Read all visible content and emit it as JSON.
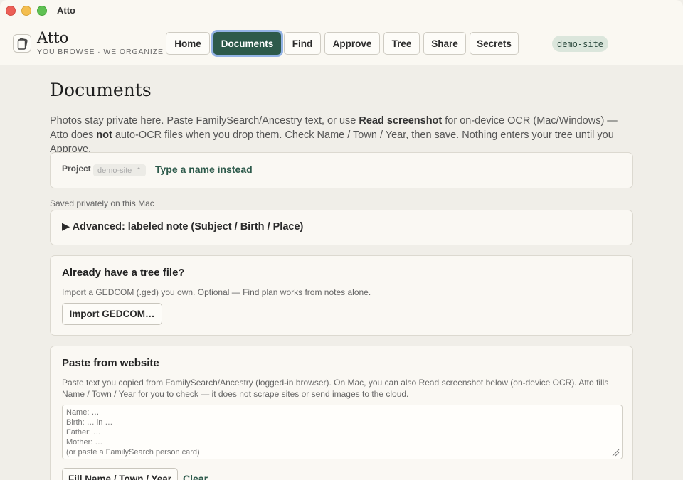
{
  "window": {
    "title": "Atto"
  },
  "brand": {
    "name": "Atto",
    "tagline": "YOU BROWSE · WE ORGANIZE",
    "icon": "tablet-icon"
  },
  "nav": {
    "items": [
      {
        "label": "Home",
        "active": false
      },
      {
        "label": "Documents",
        "active": true
      },
      {
        "label": "Find",
        "active": false
      },
      {
        "label": "Approve",
        "active": false
      },
      {
        "label": "Tree",
        "active": false
      },
      {
        "label": "Share",
        "active": false
      },
      {
        "label": "Secrets",
        "active": false
      }
    ]
  },
  "site_badge": "demo-site",
  "page": {
    "title": "Documents",
    "intro_part1": "Photos stay private here. Paste FamilySearch/Ancestry text, or use ",
    "intro_bold1": "Read screenshot",
    "intro_part2": " for on-device OCR (Mac/Windows) — Atto does ",
    "intro_bold2": "not",
    "intro_part3": " auto-OCR files when you drop them. Check Name / Town / Year, then save. Nothing enters your tree until you Approve."
  },
  "project": {
    "label": "Project",
    "selected": "demo-site",
    "link": "Type a name instead"
  },
  "saved_note": "Saved privately on this Mac",
  "advanced": {
    "label": "▶ Advanced: labeled note (Subject / Birth / Place)"
  },
  "tree_file": {
    "title": "Already have a tree file?",
    "description": "Import a GEDCOM (.ged) you own. Optional — Find plan works from notes alone.",
    "button": "Import GEDCOM…"
  },
  "paste": {
    "title": "Paste from website",
    "description": "Paste text you copied from FamilySearch/Ancestry (logged-in browser). On Mac, you can also Read screenshot below (on-device OCR). Atto fills Name / Town / Year for you to check — it does not scrape sites or send images to the cloud.",
    "placeholder": "Name: …\nBirth: … in …\nFather: …\nMother: …\n(or paste a FamilySearch person card)",
    "fill_button": "Fill Name / Town / Year",
    "clear_link": "Clear"
  },
  "colors": {
    "accent": "#2d5a4b",
    "focus_ring": "#93b3e6",
    "background": "#f0eee8"
  }
}
